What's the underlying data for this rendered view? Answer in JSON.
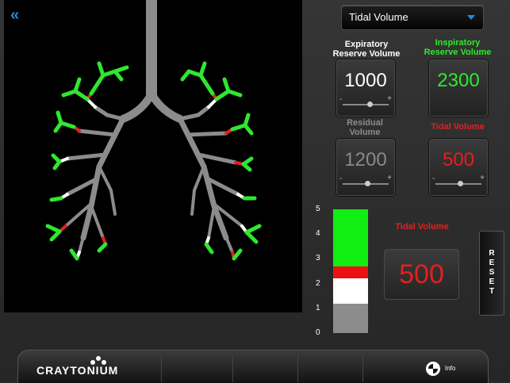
{
  "nav": {
    "back_glyph": "«"
  },
  "dropdown": {
    "selected": "Tidal Volume"
  },
  "volumes": {
    "erv": {
      "label_line1": "Expiratory",
      "label_line2": "Reserve Volume",
      "value": "1000",
      "slider_level": 0.6
    },
    "irv": {
      "label_line1": "Inspiratory",
      "label_line2": "Reserve Volume",
      "value": "2300"
    },
    "rv": {
      "label_line1": "Residual",
      "label_line2": "Volume",
      "value": "1200",
      "slider_level": 0.55
    },
    "tv": {
      "label": "Tidal Volume",
      "value": "500",
      "slider_level": 0.55
    }
  },
  "slider": {
    "minus": "-",
    "plus": "+"
  },
  "bar": {
    "ticks": [
      "5",
      "4",
      "3",
      "2",
      "1",
      "0"
    ],
    "segments": [
      {
        "name": "residual",
        "from": 0,
        "to": 1.2,
        "color": "#8c8c8c"
      },
      {
        "name": "expiratory-reserve",
        "from": 1.2,
        "to": 2.2,
        "color": "#ffffff"
      },
      {
        "name": "tidal",
        "from": 2.2,
        "to": 2.7,
        "color": "#ee1111"
      },
      {
        "name": "inspiratory-reserve",
        "from": 2.7,
        "to": 5.0,
        "color": "#11ee11"
      }
    ]
  },
  "tidal_display": {
    "label": "Tidal Volume",
    "value": "500"
  },
  "reset": {
    "label": "RESET"
  },
  "footer": {
    "logo": "CRAYTONIUM",
    "info_label": "Info"
  },
  "colors": {
    "accent": "#1e8fe0",
    "green": "#2ee82e",
    "red": "#e81e1e",
    "airway": "#8c8c8c"
  }
}
